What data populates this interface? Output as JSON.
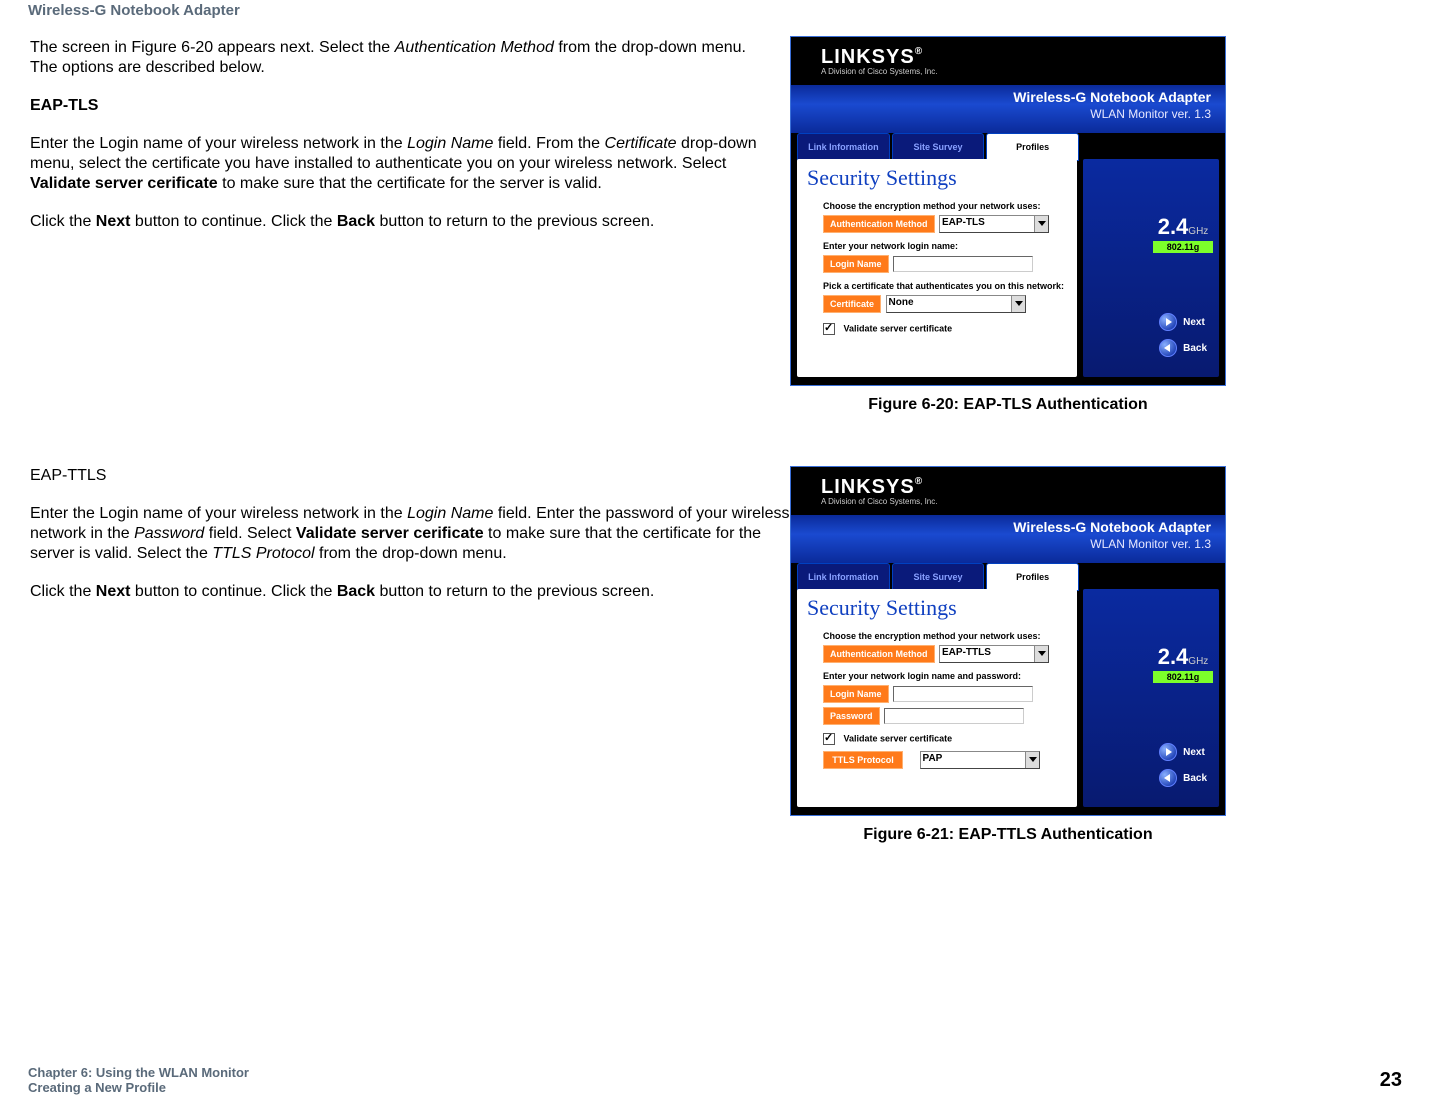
{
  "header": {
    "product": "Wireless-G Notebook Adapter"
  },
  "section1": {
    "intro_a": "The screen in Figure 6-20 appears next. Select the ",
    "intro_b": "Authentication Method",
    "intro_c": " from the drop-down menu. The options are described below.",
    "head": "EAP-TLS",
    "p2_a": "Enter the Login name of your wireless network in the ",
    "p2_b": "Login Name",
    "p2_c": " field. From the ",
    "p2_d": "Certificate",
    "p2_e": " drop-down menu, select the certificate you have installed to authenticate you on your wireless network. Select ",
    "p2_f": "Validate server cerificate",
    "p2_g": " to make sure that the certificate for the server is valid.",
    "p3_a": "Click the ",
    "p3_b": "Next",
    "p3_c": " button to continue. Click the ",
    "p3_d": "Back",
    "p3_e": " button to return to the previous screen."
  },
  "section2": {
    "head": "EAP-TTLS",
    "p1_a": "Enter the Login name of your wireless network in the ",
    "p1_b": "Login Name",
    "p1_c": " field. Enter the password of your wireless network in the ",
    "p1_d": "Password",
    "p1_e": " field. Select ",
    "p1_f": "Validate server cerificate",
    "p1_g": " to make sure that the certificate for the server is valid. Select the ",
    "p1_h": "TTLS Protocol",
    "p1_i": " from the drop-down menu.",
    "p2_a": "Click the ",
    "p2_b": "Next",
    "p2_c": " button to continue. Click the ",
    "p2_d": "Back",
    "p2_e": " button to return to the previous screen."
  },
  "app": {
    "brand": "LINKSYS",
    "brand_sub": "A Division of Cisco Systems, Inc.",
    "band_title": "Wireless-G Notebook Adapter",
    "band_sub": "WLAN Monitor  ver. 1.3",
    "tabs": {
      "t1": "Link Information",
      "t2": "Site Survey",
      "t3": "Profiles"
    },
    "panel_title": "Security Settings",
    "lbl_choose": "Choose the encryption method your network uses:",
    "lbl_authmethod": "Authentication Method",
    "lbl_login_hdr_tls": "Enter your network login name:",
    "lbl_login_hdr_ttls": "Enter your network login name and password:",
    "lbl_login": "Login Name",
    "lbl_cert_hdr": "Pick a certificate that authenticates you on this network:",
    "lbl_cert": "Certificate",
    "cert_value": "None",
    "lbl_validate": "Validate server certificate",
    "lbl_password": "Password",
    "lbl_ttlsproto": "TTLS Protocol",
    "ttls_value": "PAP",
    "val_eaptls": "EAP-TLS",
    "val_eapttls": "EAP-TTLS",
    "ghz_num": "2.4",
    "ghz_unit": "GHz",
    "ghz_std": "802.11g",
    "btn_next": "Next",
    "btn_back": "Back",
    "reg": "®"
  },
  "captions": {
    "fig1": "Figure 6-20: EAP-TLS Authentication",
    "fig2": "Figure 6-21: EAP-TTLS Authentication"
  },
  "footer": {
    "line1": "Chapter 6: Using the WLAN Monitor",
    "line2": "Creating a New Profile",
    "page": "23"
  }
}
